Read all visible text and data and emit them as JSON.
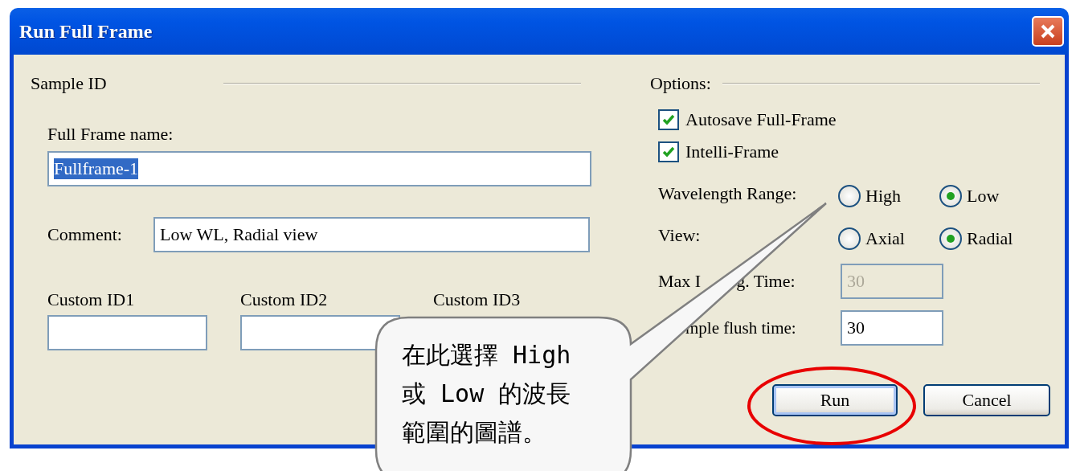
{
  "window": {
    "title": "Run Full Frame"
  },
  "sample_id": {
    "heading": "Sample ID",
    "full_frame_name": {
      "label": "Full Frame name:",
      "value": "Fullframe-1",
      "selected": true
    },
    "comment": {
      "label": "Comment:",
      "value": "Low WL, Radial view"
    },
    "custom_ids": [
      {
        "label": "Custom ID1",
        "kind": "field"
      },
      {
        "label": "Custom ID2",
        "kind": "field"
      },
      {
        "label": "Custom ID3",
        "kind": "hidden"
      }
    ]
  },
  "options": {
    "heading": "Options:",
    "checkboxes": [
      {
        "label": "Autosave Full-Frame",
        "checked": true
      },
      {
        "label": "Intelli-Frame",
        "checked": true
      }
    ],
    "radio_groups": [
      {
        "label": "Wavelength Range:",
        "choices": [
          {
            "label": "High",
            "selected": false
          },
          {
            "label": "Low",
            "selected": true
          }
        ]
      },
      {
        "label": "View:",
        "choices": [
          {
            "label": "Axial",
            "selected": false
          },
          {
            "label": "Radial",
            "selected": true
          }
        ]
      }
    ],
    "max_integ_time": {
      "label_parts": [
        "Max I",
        "g. Time:"
      ],
      "value": "30",
      "disabled": true
    },
    "sample_flush_time": {
      "label": "mple flush time:",
      "value": "30",
      "disabled": false
    }
  },
  "buttons": [
    {
      "label": "Run",
      "default": true,
      "highlighted": true
    },
    {
      "label": "Cancel",
      "default": false,
      "highlighted": false
    }
  ],
  "callout": {
    "lines": [
      "在此選擇 High",
      "或 Low 的波長",
      "範圍的圖譜。"
    ]
  }
}
